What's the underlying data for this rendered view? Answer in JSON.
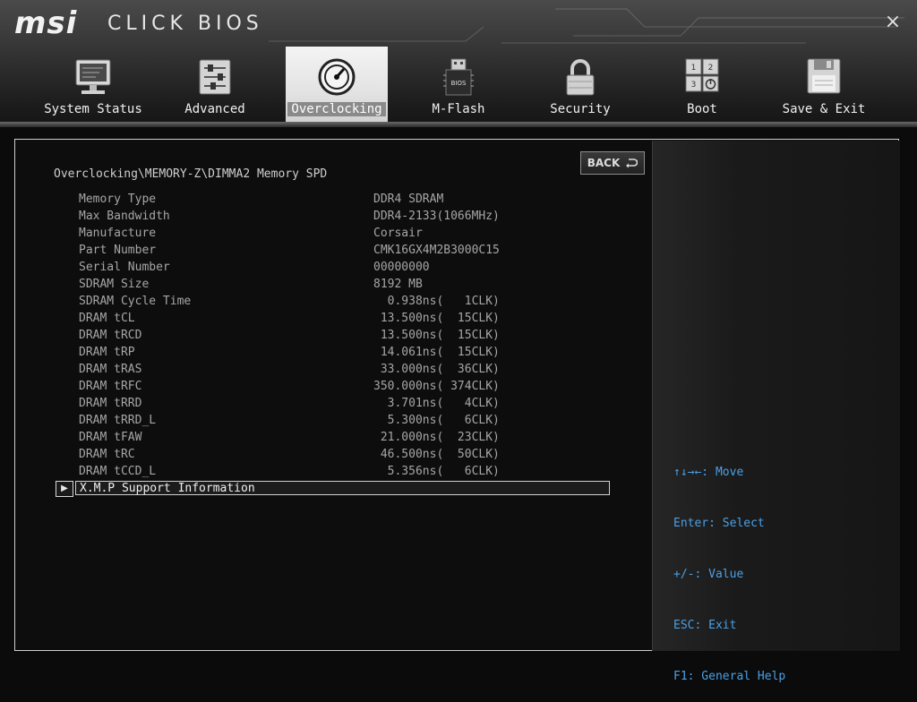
{
  "header": {
    "logo": "msi",
    "subtitle": "CLICK BIOS",
    "close": "×"
  },
  "nav": {
    "tabs": [
      {
        "label": "System Status",
        "icon": "monitor-icon",
        "active": false
      },
      {
        "label": "Advanced",
        "icon": "sliders-icon",
        "active": false
      },
      {
        "label": "Overclocking",
        "icon": "gauge-icon",
        "active": true
      },
      {
        "label": "M-Flash",
        "icon": "usb-bios-icon",
        "active": false
      },
      {
        "label": "Security",
        "icon": "padlock-icon",
        "active": false
      },
      {
        "label": "Boot",
        "icon": "boot-order-icon",
        "active": false
      },
      {
        "label": "Save & Exit",
        "icon": "floppy-icon",
        "active": false
      }
    ]
  },
  "main": {
    "breadcrumb": "Overclocking\\MEMORY-Z\\DIMMA2 Memory SPD",
    "back_label": "BACK",
    "spd": [
      {
        "key": "Memory Type",
        "value": "DDR4 SDRAM"
      },
      {
        "key": "Max Bandwidth",
        "value": "DDR4-2133(1066MHz)"
      },
      {
        "key": "Manufacture",
        "value": "Corsair"
      },
      {
        "key": "Part Number",
        "value": "CMK16GX4M2B3000C15"
      },
      {
        "key": "Serial Number",
        "value": "00000000"
      },
      {
        "key": "SDRAM Size",
        "value": "8192 MB"
      },
      {
        "key": "SDRAM Cycle Time",
        "value": "  0.938ns(   1CLK)"
      },
      {
        "key": "DRAM tCL",
        "value": " 13.500ns(  15CLK)"
      },
      {
        "key": "DRAM tRCD",
        "value": " 13.500ns(  15CLK)"
      },
      {
        "key": "DRAM tRP",
        "value": " 14.061ns(  15CLK)"
      },
      {
        "key": "DRAM tRAS",
        "value": " 33.000ns(  36CLK)"
      },
      {
        "key": "DRAM tRFC",
        "value": "350.000ns( 374CLK)"
      },
      {
        "key": "DRAM tRRD",
        "value": "  3.701ns(   4CLK)"
      },
      {
        "key": "DRAM tRRD_L",
        "value": "  5.300ns(   6CLK)"
      },
      {
        "key": "DRAM tFAW",
        "value": " 21.000ns(  23CLK)"
      },
      {
        "key": "DRAM tRC",
        "value": " 46.500ns(  50CLK)"
      },
      {
        "key": "DRAM tCCD_L",
        "value": "  5.356ns(   6CLK)"
      }
    ],
    "xmp_label": "X.M.P Support Information"
  },
  "help": {
    "lines": [
      "↑↓→←: Move",
      "Enter: Select",
      "+/-: Value",
      "ESC: Exit",
      "F1: General Help"
    ]
  },
  "colors": {
    "help_text": "#4aa0e6",
    "active_tab": "#e2e2e2"
  }
}
